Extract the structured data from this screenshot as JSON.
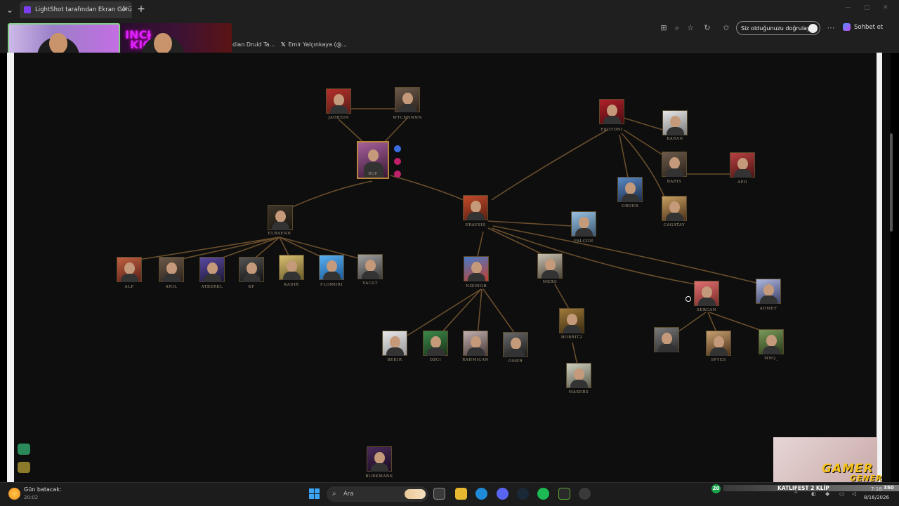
{
  "browser": {
    "tab_title": "LightShot tarafından Ekran Görünt",
    "tab_close": "✕",
    "new_tab": "+",
    "verify_label": "Siz olduğunuzu doğrulayın",
    "chat_label": "Sohbet et",
    "bookmarks": [
      {
        "label": "dian Druid Ta..."
      },
      {
        "label": "Emir Yalçınkaya (@..."
      }
    ]
  },
  "tree": {
    "nodes": [
      {
        "id": "jahrein",
        "label": "JAHREIN"
      },
      {
        "id": "wtcn",
        "label": "WTCNNNNN"
      },
      {
        "id": "rcp",
        "label": "RCP"
      },
      {
        "id": "elraenn",
        "label": "ELRAENN"
      },
      {
        "id": "eray",
        "label": "ERAYSIS"
      },
      {
        "id": "ekotoni",
        "label": "EKOTONI"
      },
      {
        "id": "baran",
        "label": "BARAN"
      },
      {
        "id": "baris",
        "label": "BARIS"
      },
      {
        "id": "apo",
        "label": "APO"
      },
      {
        "id": "order",
        "label": "ORDER"
      },
      {
        "id": "cagatay",
        "label": "CAGATAY"
      },
      {
        "id": "falcon",
        "label": "FALCON"
      },
      {
        "id": "alp",
        "label": "ALP"
      },
      {
        "id": "anil",
        "label": "ANIL"
      },
      {
        "id": "atberk",
        "label": "ATBERKL"
      },
      {
        "id": "kf",
        "label": "KF"
      },
      {
        "id": "kadir",
        "label": "KADIR"
      },
      {
        "id": "flomori",
        "label": "FLOMORI"
      },
      {
        "id": "vault",
        "label": "VAULT"
      },
      {
        "id": "nizinor",
        "label": "NIZINOR"
      },
      {
        "id": "mero",
        "label": "MERO"
      },
      {
        "id": "sercan",
        "label": "SERCAN"
      },
      {
        "id": "ahmet",
        "label": "AHMET"
      },
      {
        "id": "bekir",
        "label": "BEKIR"
      },
      {
        "id": "dzci",
        "label": "DZCI"
      },
      {
        "id": "rahmican",
        "label": "RAHMICAN"
      },
      {
        "id": "omer",
        "label": "OMER"
      },
      {
        "id": "hobbit",
        "label": "HOBBIT2"
      },
      {
        "id": "maxers",
        "label": "MAXERS"
      },
      {
        "id": "redname",
        "label": "",
        "red": true
      },
      {
        "id": "spyes",
        "label": "SPYES"
      },
      {
        "id": "mnq",
        "label": "MNQ_"
      },
      {
        "id": "burkmank",
        "label": "BURKMANK"
      }
    ]
  },
  "overlay": {
    "gamer_line1": "GAMER",
    "gamer_line2": "GENER",
    "stream_badge": "20",
    "stream_banner": "KATLIFEST 2 KLİP",
    "stream_count": "350"
  },
  "taskbar": {
    "weather_title": "Gün batacak:",
    "weather_time": "20:02",
    "search_placeholder": "Ara",
    "clock_time": "7:18",
    "clock_date": "8/16/2026"
  },
  "colors": {
    "accent_border": "#b8863b",
    "node_label": "#a99c82",
    "edge": "#7a5a32"
  }
}
